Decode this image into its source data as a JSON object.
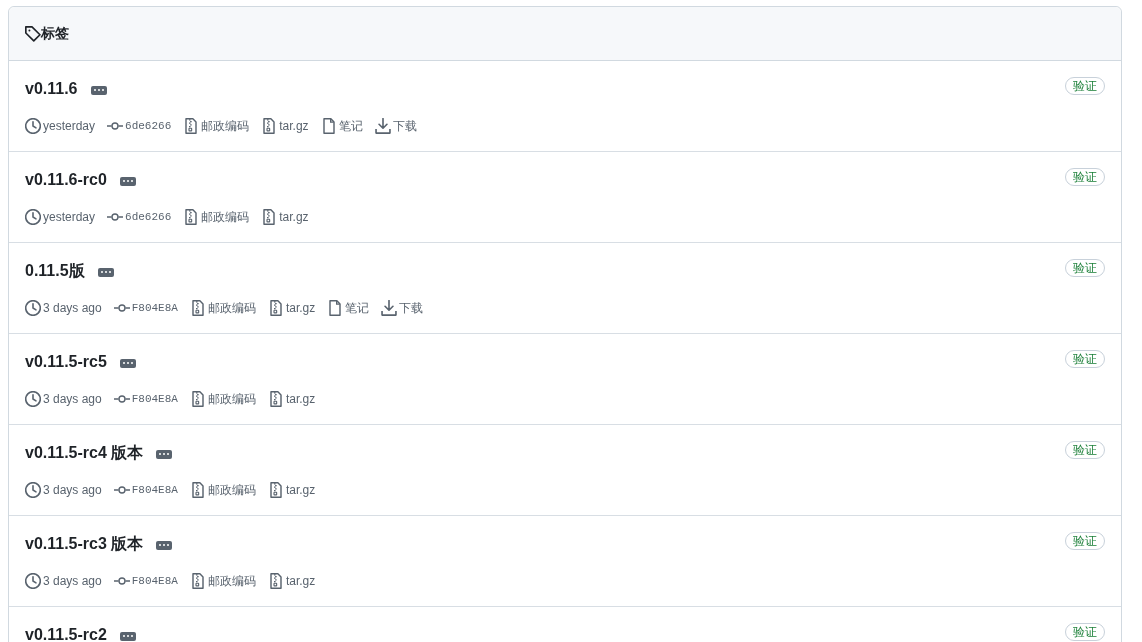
{
  "header": {
    "title": "标签"
  },
  "tags": [
    {
      "name": "v0.11.6",
      "badge": "验证",
      "meta": [
        {
          "kind": "time",
          "text": "yesterday"
        },
        {
          "kind": "commit",
          "text": "6de6266"
        },
        {
          "kind": "zip",
          "text": "邮政编码"
        },
        {
          "kind": "zip",
          "text": "tar.gz"
        },
        {
          "kind": "notes",
          "text": "笔记"
        },
        {
          "kind": "download",
          "text": "下载"
        }
      ]
    },
    {
      "name": "v0.11.6-rc0",
      "badge": "验证",
      "meta": [
        {
          "kind": "time",
          "text": "yesterday"
        },
        {
          "kind": "commit",
          "text": "6de6266"
        },
        {
          "kind": "zip",
          "text": "邮政编码"
        },
        {
          "kind": "zip",
          "text": "tar.gz"
        }
      ]
    },
    {
      "name": "0.11.5版",
      "badge": "验证",
      "meta": [
        {
          "kind": "time",
          "text": "3 days ago"
        },
        {
          "kind": "commit",
          "text": "F804E8A"
        },
        {
          "kind": "zip",
          "text": "邮政编码"
        },
        {
          "kind": "zip",
          "text": "tar.gz"
        },
        {
          "kind": "notes",
          "text": "笔记"
        },
        {
          "kind": "download",
          "text": "下载"
        }
      ]
    },
    {
      "name": "v0.11.5-rc5",
      "badge": "验证",
      "meta": [
        {
          "kind": "time",
          "text": "3 days ago"
        },
        {
          "kind": "commit",
          "text": "F804E8A"
        },
        {
          "kind": "zip",
          "text": "邮政编码"
        },
        {
          "kind": "zip",
          "text": "tar.gz"
        }
      ]
    },
    {
      "name": "v0.11.5-rc4 版本",
      "badge": "验证",
      "meta": [
        {
          "kind": "time",
          "text": "3 days ago"
        },
        {
          "kind": "commit",
          "text": "F804E8A"
        },
        {
          "kind": "zip",
          "text": "邮政编码"
        },
        {
          "kind": "zip",
          "text": "tar.gz"
        }
      ]
    },
    {
      "name": "v0.11.5-rc3 版本",
      "badge": "验证",
      "meta": [
        {
          "kind": "time",
          "text": "3 days ago"
        },
        {
          "kind": "commit",
          "text": "F804E8A"
        },
        {
          "kind": "zip",
          "text": "邮政编码"
        },
        {
          "kind": "zip",
          "text": "tar.gz"
        }
      ]
    },
    {
      "name": "v0.11.5-rc2",
      "badge": "验证"
    }
  ]
}
